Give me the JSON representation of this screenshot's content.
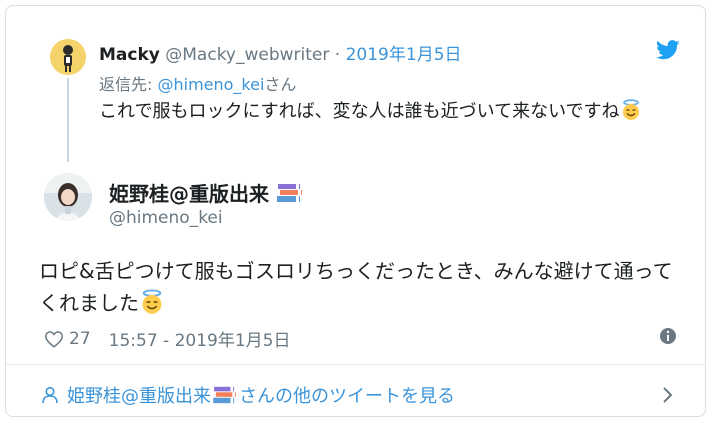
{
  "parent": {
    "name": "Macky",
    "handle": "@Macky_webwriter",
    "separator": " · ",
    "date": "2019年1月5日",
    "reply_prefix": "返信先: ",
    "reply_to": "@himeno_kei",
    "reply_suffix": "さん",
    "text": "これで服もロックにすれば、変な人は誰も近づいて来ないですね",
    "emoji": "smiling-face-with-halo"
  },
  "tweet": {
    "name": "姫野桂@重版出来",
    "name_emoji": "books",
    "handle": "@himeno_kei",
    "text": "ロピ&舌ピつけて服もゴスロリちっくだったとき、みんな避けて通ってくれました",
    "emoji": "smiling-face-with-halo",
    "likes": "27",
    "time": "15:57 - 2019年1月5日"
  },
  "footer": {
    "name": "姫野桂@重版出来",
    "suffix": "さんの他のツイートを見る"
  },
  "colors": {
    "link": "#3b94d9",
    "muted": "#697882",
    "text": "#1c2022",
    "brand": "#1da1f2"
  }
}
